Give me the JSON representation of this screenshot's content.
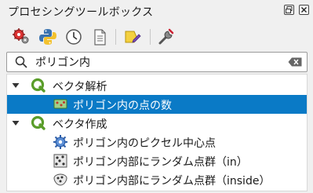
{
  "window": {
    "title": "プロセシングツールボックス"
  },
  "toolbar": {
    "icons": [
      "models-icon",
      "python-icon",
      "history-icon",
      "results-icon",
      "edit-features-icon",
      "settings-icon"
    ]
  },
  "search": {
    "value": "ポリゴン内"
  },
  "tree": {
    "groups": [
      {
        "label": "ベクタ解析",
        "items": [
          {
            "label": "ポリゴン内の点の数",
            "selected": true
          }
        ]
      },
      {
        "label": "ベクタ作成",
        "items": [
          {
            "label": "ポリゴン内のピクセル中心点"
          },
          {
            "label": "ポリゴン内部にランダム点群（in）"
          },
          {
            "label": "ポリゴン内部にランダム点群（inside）"
          }
        ]
      }
    ]
  },
  "colors": {
    "selection": "#0a7ac6",
    "qgis_green": "#5a9d2a"
  }
}
